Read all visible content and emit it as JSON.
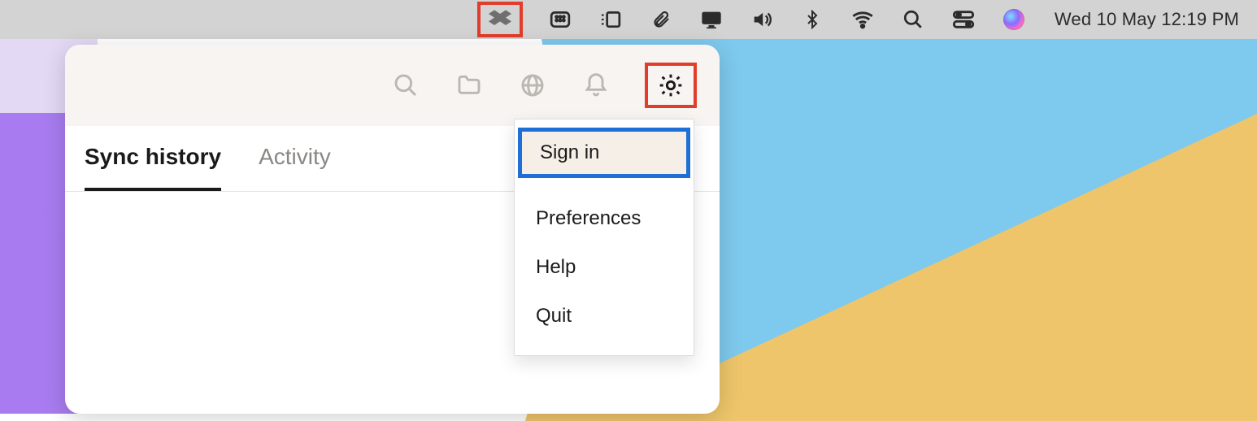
{
  "menubar": {
    "clock": "Wed 10 May  12:19 PM",
    "icons": {
      "dropbox": "dropbox-icon",
      "keyboard_viewer": "keyboard-viewer-icon",
      "stage_manager": "stage-manager-icon",
      "attachment": "paperclip-icon",
      "display": "display-icon",
      "volume": "volume-icon",
      "bluetooth": "bluetooth-icon",
      "wifi": "wifi-icon",
      "spotlight": "search-icon",
      "control_center": "control-center-icon",
      "siri": "siri-icon"
    },
    "highlight": {
      "dropbox": "#e23c2a",
      "gear": "#e23c2a",
      "signin": "#1f6fd6"
    }
  },
  "panel": {
    "toolbar_icons": {
      "search": "search-icon",
      "folder": "folder-icon",
      "globe": "globe-icon",
      "bell": "bell-icon",
      "gear": "gear-icon"
    },
    "tabs": [
      {
        "label": "Sync history",
        "active": true
      },
      {
        "label": "Activity",
        "active": false
      }
    ],
    "dropdown": [
      {
        "label": "Sign in",
        "highlight": true
      },
      {
        "label": "Preferences",
        "highlight": false
      },
      {
        "label": "Help",
        "highlight": false
      },
      {
        "label": "Quit",
        "highlight": false
      }
    ]
  }
}
